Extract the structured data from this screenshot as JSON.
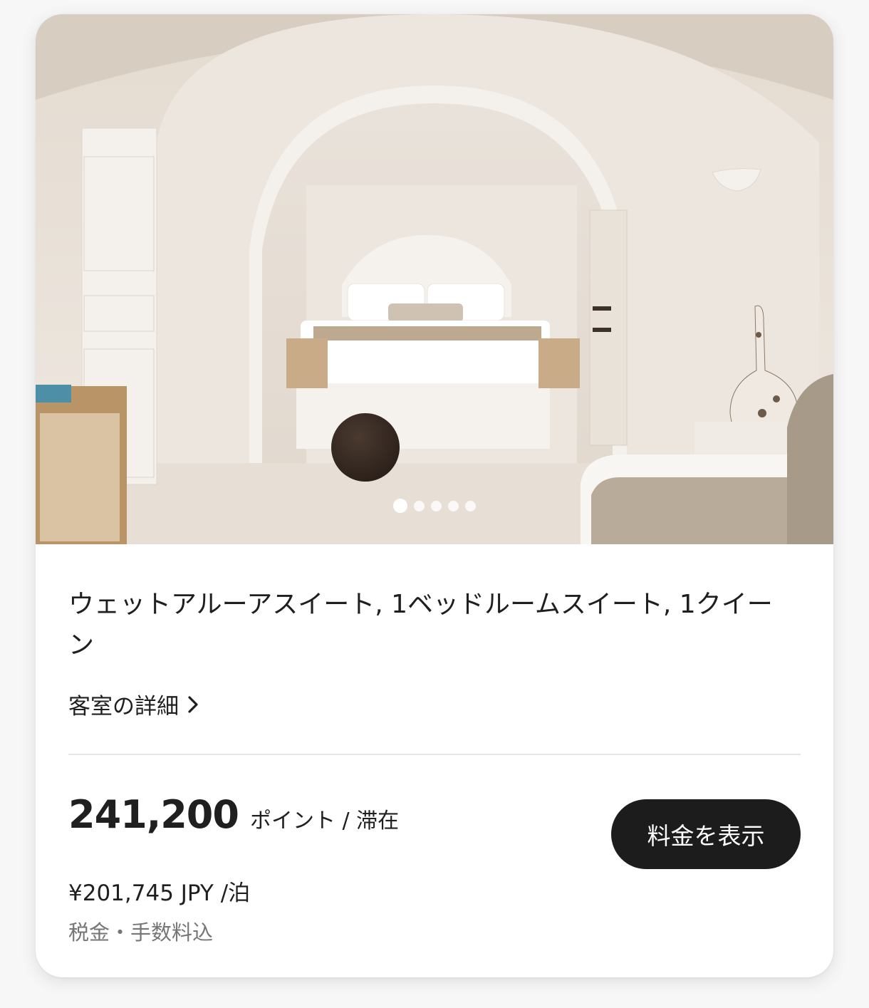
{
  "room": {
    "photo_alt": "",
    "carousel": {
      "total": 5,
      "active_index": 0
    },
    "title": "ウェットアルーアスイート, 1ベッドルームスイート, 1クイーン",
    "details_link": "客室の詳細",
    "chevron_icon": "chevron-right-icon"
  },
  "pricing": {
    "points_value": "241,200",
    "points_unit": "ポイント / 滞在",
    "yen_amount": "¥201,745",
    "yen_currency": "JPY",
    "yen_per": "/泊",
    "tax_note": "税金・手数料込"
  },
  "actions": {
    "view_rates_label": "料金を表示"
  },
  "colors": {
    "button_bg": "#1c1c1c",
    "button_text": "#ffffff",
    "muted_text": "#767676",
    "divider": "#e5e5e5"
  }
}
